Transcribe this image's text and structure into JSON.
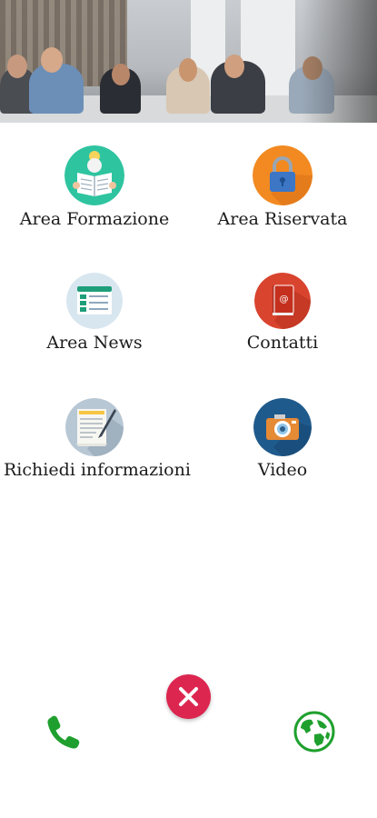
{
  "menu": {
    "items": [
      {
        "label": "Area Formazione",
        "icon": "training-icon"
      },
      {
        "label": "Area Riservata",
        "icon": "lock-icon"
      },
      {
        "label": "Area News",
        "icon": "news-icon"
      },
      {
        "label": "Contatti",
        "icon": "contacts-book-icon"
      },
      {
        "label": "Richiedi informazioni",
        "icon": "document-pen-icon"
      },
      {
        "label": "Video",
        "icon": "camera-icon"
      }
    ]
  },
  "actions": {
    "close_icon": "close-icon",
    "phone_icon": "phone-icon",
    "web_icon": "globe-icon"
  },
  "colors": {
    "close_button": "#dc2650",
    "action_green": "#1fa02e",
    "training_bg": "#2ec4a0",
    "lock_bg": "#f28a21",
    "news_bg": "#d8e6f0",
    "contacts_bg": "#d9442f",
    "document_bg": "#b8c7d4",
    "camera_bg": "#1f5a8c"
  }
}
